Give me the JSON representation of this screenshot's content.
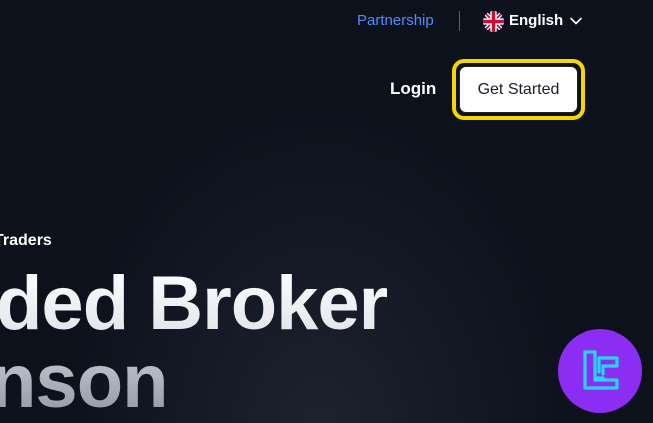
{
  "nav": {
    "partnership_label": "Partnership",
    "language": {
      "label": "English",
      "flag_icon": "uk-flag-icon",
      "chevron_icon": "chevron-down-icon"
    },
    "login_label": "Login",
    "get_started_label": "Get Started"
  },
  "hero": {
    "eyebrow": "Traders",
    "headline_line1": "ded Broker",
    "headline_line2": "nson"
  },
  "badge": {
    "icon": "tc-logo-icon"
  },
  "colors": {
    "background": "#0d111c",
    "link_blue": "#4f8dff",
    "highlight_yellow": "#f5d600",
    "badge_purple": "#8b2df2",
    "badge_cyan": "#25d7ff"
  }
}
